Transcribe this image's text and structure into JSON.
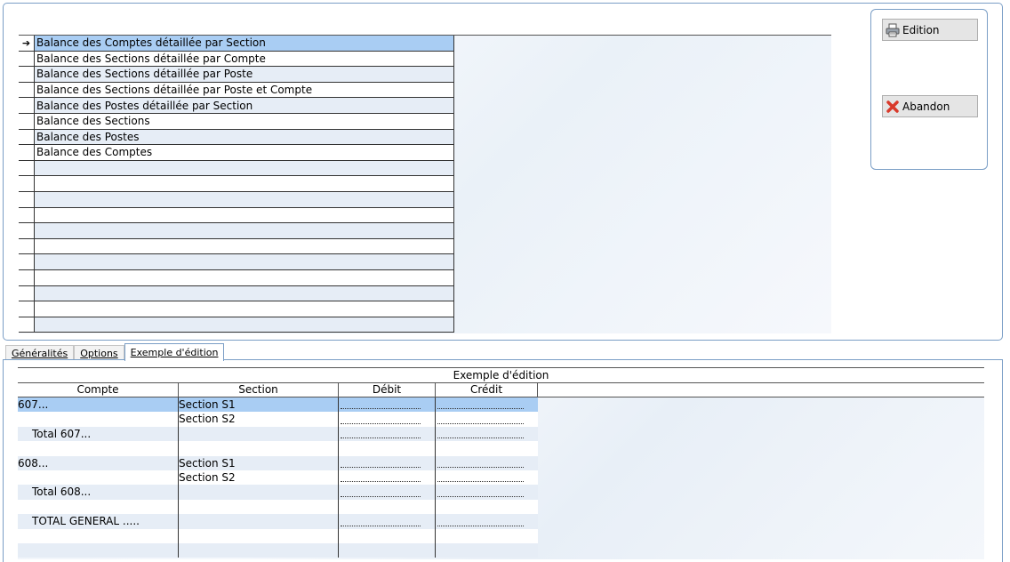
{
  "reports": {
    "items": [
      "Balance des Comptes détaillée par Section",
      "Balance des Sections détaillée par Compte",
      "Balance des Sections détaillée par Poste",
      "Balance des Sections détaillée par Poste et Compte",
      "Balance des Postes détaillée par Section",
      "Balance des Sections",
      "Balance des Postes",
      "Balance des Comptes"
    ],
    "selected_indicator": "➔"
  },
  "actions": {
    "edition_label": "Edition",
    "abandon_label": "Abandon"
  },
  "tabs": {
    "generalites": "Généralités",
    "options": "Options",
    "exemple": "Exemple d'édition"
  },
  "example": {
    "title": "Exemple d'édition",
    "headers": {
      "compte": "Compte",
      "section": "Section",
      "debit": "Débit",
      "credit": "Crédit"
    },
    "rows": [
      {
        "compte": "607...",
        "section": "Section S1",
        "indent": false,
        "dots": true
      },
      {
        "compte": "",
        "section": "Section S2",
        "indent": false,
        "dots": true
      },
      {
        "compte": "Total  607...",
        "section": "",
        "indent": true,
        "dots": true
      },
      {
        "compte": "",
        "section": "",
        "indent": false,
        "dots": false
      },
      {
        "compte": "608...",
        "section": "Section S1",
        "indent": false,
        "dots": true
      },
      {
        "compte": "",
        "section": "Section S2",
        "indent": false,
        "dots": true
      },
      {
        "compte": "Total  608...",
        "section": "",
        "indent": true,
        "dots": true
      },
      {
        "compte": "",
        "section": "",
        "indent": false,
        "dots": false
      },
      {
        "compte": "TOTAL GENERAL .....",
        "section": "",
        "indent": true,
        "dots": true
      },
      {
        "compte": "",
        "section": "",
        "indent": false,
        "dots": false
      },
      {
        "compte": "",
        "section": "",
        "indent": false,
        "dots": false
      }
    ]
  },
  "colors": {
    "selection": "#a9cdf3",
    "alt_row": "#e6edf6",
    "border_accent": "#7a9ec6"
  }
}
